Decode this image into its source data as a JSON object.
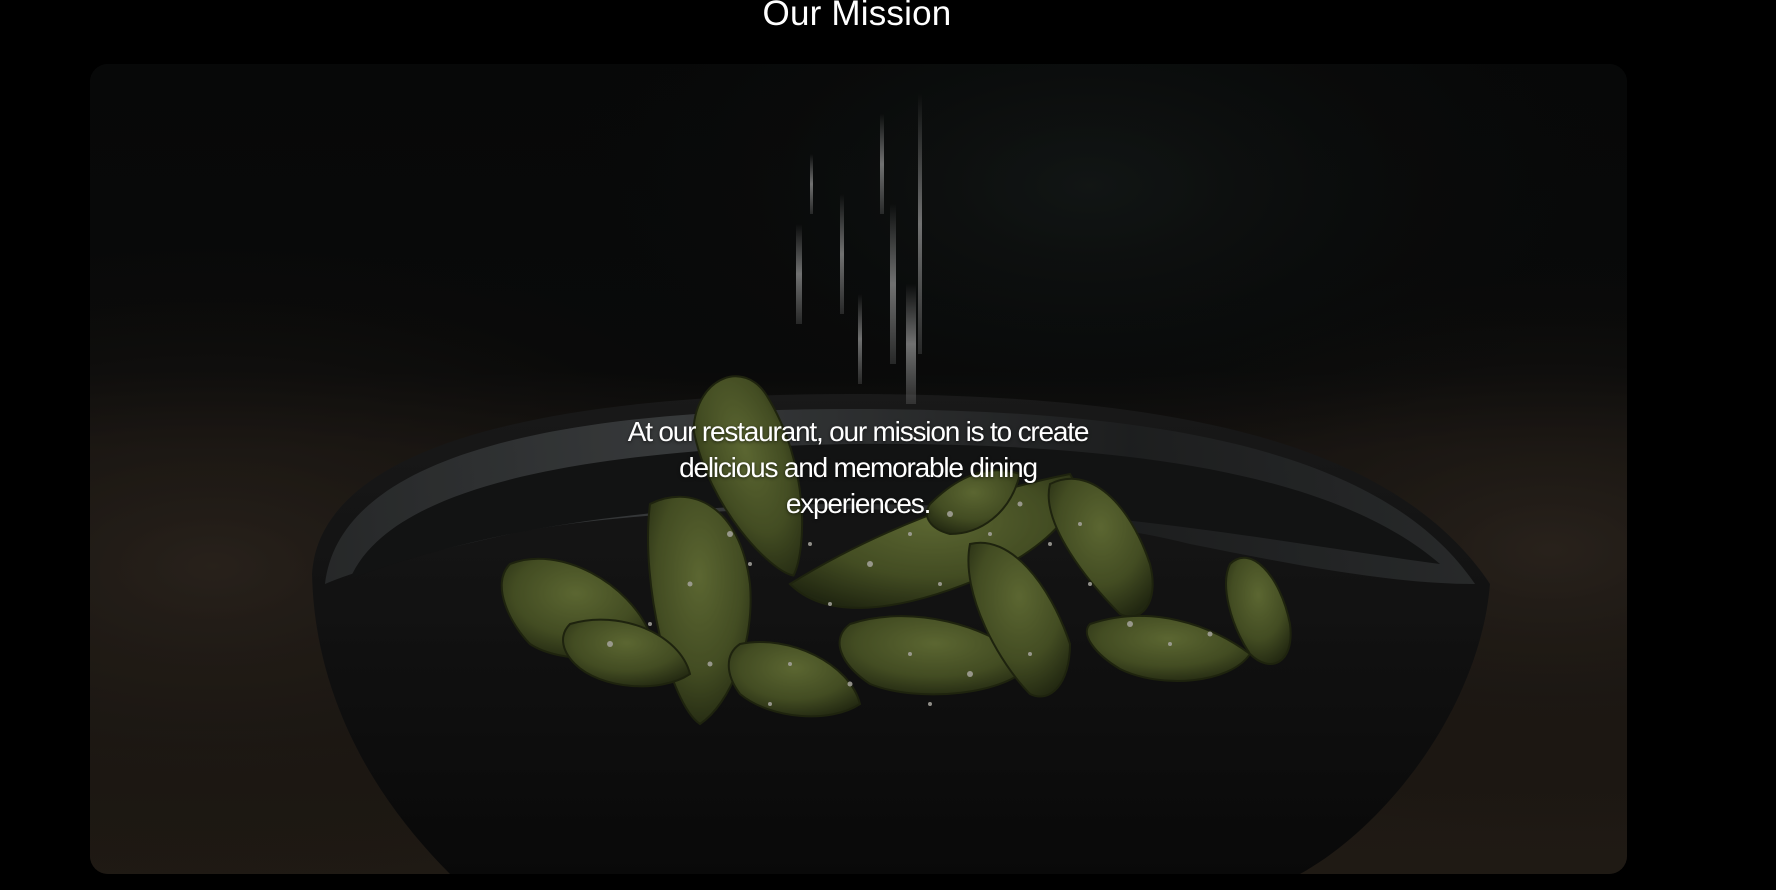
{
  "mission": {
    "title": "Our Mission",
    "statement": "At our restaurant, our mission is to create delicious and memorable dining experiences."
  },
  "image": {
    "subject": "edamame-bowl-photo",
    "overlay_color": "#000000"
  },
  "colors": {
    "page_background": "#000000",
    "text": "#ffffff",
    "edamame_green": "#6b7a3a",
    "bowl_dark": "#1c1c1c",
    "table_wood": "#3a3026"
  }
}
